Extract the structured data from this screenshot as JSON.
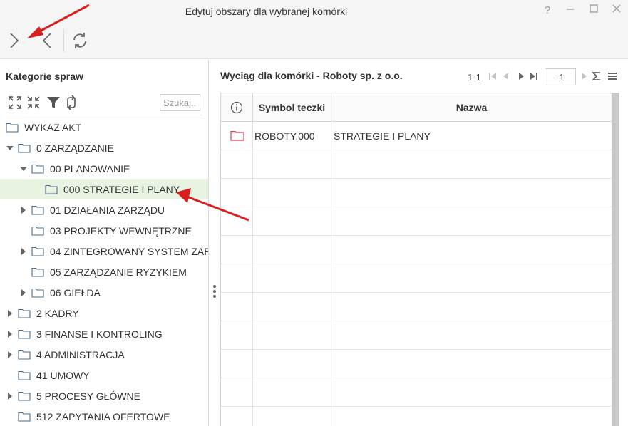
{
  "window": {
    "title": "Edytuj obszary dla wybranej komórki",
    "help_label": "?"
  },
  "left_panel": {
    "title": "Kategorie spraw",
    "search_placeholder": "Szukaj...",
    "tree": [
      {
        "label": "WYKAZ AKT",
        "level": 0,
        "expander": "none"
      },
      {
        "label": "0 ZARZĄDZANIE",
        "level": 0,
        "expander": "expanded"
      },
      {
        "label": "00 PLANOWANIE",
        "level": 1,
        "expander": "expanded"
      },
      {
        "label": "000 STRATEGIE I PLANY",
        "level": 2,
        "expander": "none",
        "selected": true
      },
      {
        "label": "01 DZIAŁANIA ZARZĄDU",
        "level": 1,
        "expander": "collapsed"
      },
      {
        "label": "03 PROJEKTY WEWNĘTRZNE",
        "level": 1,
        "expander": "none"
      },
      {
        "label": "04 ZINTEGROWANY SYSTEM ZARZ",
        "level": 1,
        "expander": "collapsed"
      },
      {
        "label": "05 ZARZĄDZANIE RYZYKIEM",
        "level": 1,
        "expander": "none"
      },
      {
        "label": "06 GIEŁDA",
        "level": 1,
        "expander": "collapsed"
      },
      {
        "label": "2 KADRY",
        "level": 0,
        "expander": "collapsed"
      },
      {
        "label": "3 FINANSE I KONTROLING",
        "level": 0,
        "expander": "collapsed"
      },
      {
        "label": "4 ADMINISTRACJA",
        "level": 0,
        "expander": "collapsed"
      },
      {
        "label": "41 UMOWY",
        "level": 0,
        "expander": "none"
      },
      {
        "label": "5 PROCESY GŁÓWNE",
        "level": 0,
        "expander": "collapsed"
      },
      {
        "label": "512 ZAPYTANIA OFERTOWE",
        "level": 0,
        "expander": "none"
      }
    ]
  },
  "right_panel": {
    "title": "Wyciąg dla komórki - Roboty sp. z o.o.",
    "pager": {
      "range": "1-1",
      "page_value": "-1"
    },
    "grid": {
      "columns": [
        "",
        "Symbol teczki",
        "Nazwa"
      ],
      "rows": [
        {
          "symbol": "ROBOTY.000",
          "name": "STRATEGIE I PLANY"
        }
      ],
      "empty_rows": 10
    }
  },
  "colors": {
    "selection_bg": "#e9f3e1",
    "annotation_arrow": "#d9201f",
    "folder_outline": "#4a6d8c",
    "record_folder": "#d9475a"
  },
  "icons": {
    "toolbar": [
      "next-icon",
      "previous-icon",
      "refresh-icon"
    ],
    "tree_tools": [
      "expand-all-icon",
      "collapse-all-icon",
      "filter-icon",
      "sync-icon"
    ],
    "pager": [
      "first-page-icon",
      "prev-page-icon",
      "next-page-icon",
      "last-page-icon",
      "go-icon",
      "sum-icon",
      "menu-icon"
    ]
  }
}
